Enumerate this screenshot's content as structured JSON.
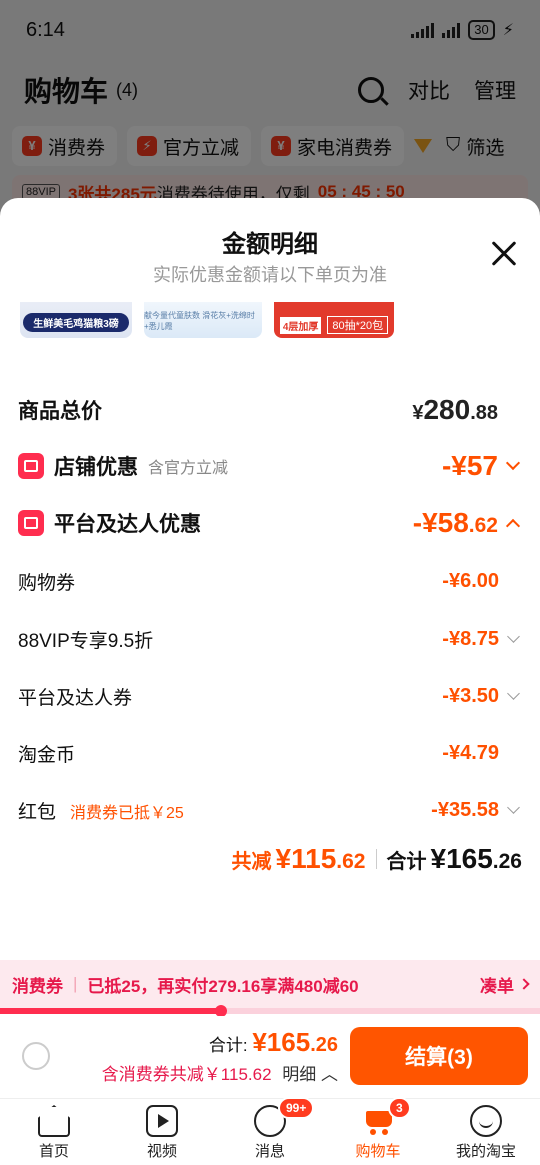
{
  "status_bar": {
    "time": "6:14",
    "battery": "30"
  },
  "header": {
    "title": "购物车",
    "count": "(4)",
    "compare": "对比",
    "manage": "管理"
  },
  "chips": [
    {
      "icon": "¥",
      "label": "消费券"
    },
    {
      "icon": "⚡",
      "label": "官方立减"
    },
    {
      "icon": "¥",
      "label": "家电消费券"
    }
  ],
  "filter_label": "筛选",
  "vip_bar": {
    "tag": "88VIP",
    "highlight": "3张共285元",
    "text": "消费券待使用，仅剩",
    "countdown": "05 : 45 : 50"
  },
  "sheet": {
    "title": "金额明细",
    "subtitle": "实际优惠金额请以下单页为准",
    "thumbs": [
      {
        "text": "生鲜美毛鸡猫粮3磅"
      },
      {
        "text": "献今量代童肤数 滑花灰+洗绵时+悉儿霞"
      },
      {
        "tag": "4层加厚",
        "text": "80抽*20包"
      }
    ],
    "goods_total": {
      "label": "商品总价",
      "yen": "¥",
      "int": "280",
      "dec": ".88"
    },
    "shop_discount": {
      "label": "店铺优惠",
      "note": "含官方立减",
      "value": "-¥57"
    },
    "platform_discount": {
      "label": "平台及达人优惠",
      "int": "-¥58",
      "dec": ".62"
    },
    "items": [
      {
        "label": "购物券",
        "value": "-¥6.00",
        "note": ""
      },
      {
        "label": "88VIP专享9.5折",
        "value": "-¥8.75",
        "note": ""
      },
      {
        "label": "平台及达人券",
        "value": "-¥3.50",
        "note": ""
      },
      {
        "label": "淘金币",
        "value": "-¥4.79",
        "note": ""
      },
      {
        "label": "红包",
        "value": "-¥35.58",
        "note": "消费券已抵￥25"
      }
    ],
    "summary": {
      "saved_label": "共减",
      "saved_int": "¥115",
      "saved_dec": ".62",
      "total_label": "合计",
      "total_int": "¥165",
      "total_dec": ".26"
    }
  },
  "coupon_bar": {
    "label": "消费券",
    "text": "已抵25，再实付279.16享满480减60",
    "action": "凑单",
    "progress": 0.41
  },
  "checkout": {
    "total_label": "合计:",
    "total_int": "¥165",
    "total_dec": ".26",
    "discount_text": "含消费券共减￥115.62",
    "detail_label": "明细",
    "pay_label": "结算(3)"
  },
  "tabbar": [
    {
      "label": "首页",
      "badge": ""
    },
    {
      "label": "视频",
      "badge": ""
    },
    {
      "label": "消息",
      "badge": "99+"
    },
    {
      "label": "购物车",
      "badge": "3"
    },
    {
      "label": "我的淘宝",
      "badge": ""
    }
  ]
}
